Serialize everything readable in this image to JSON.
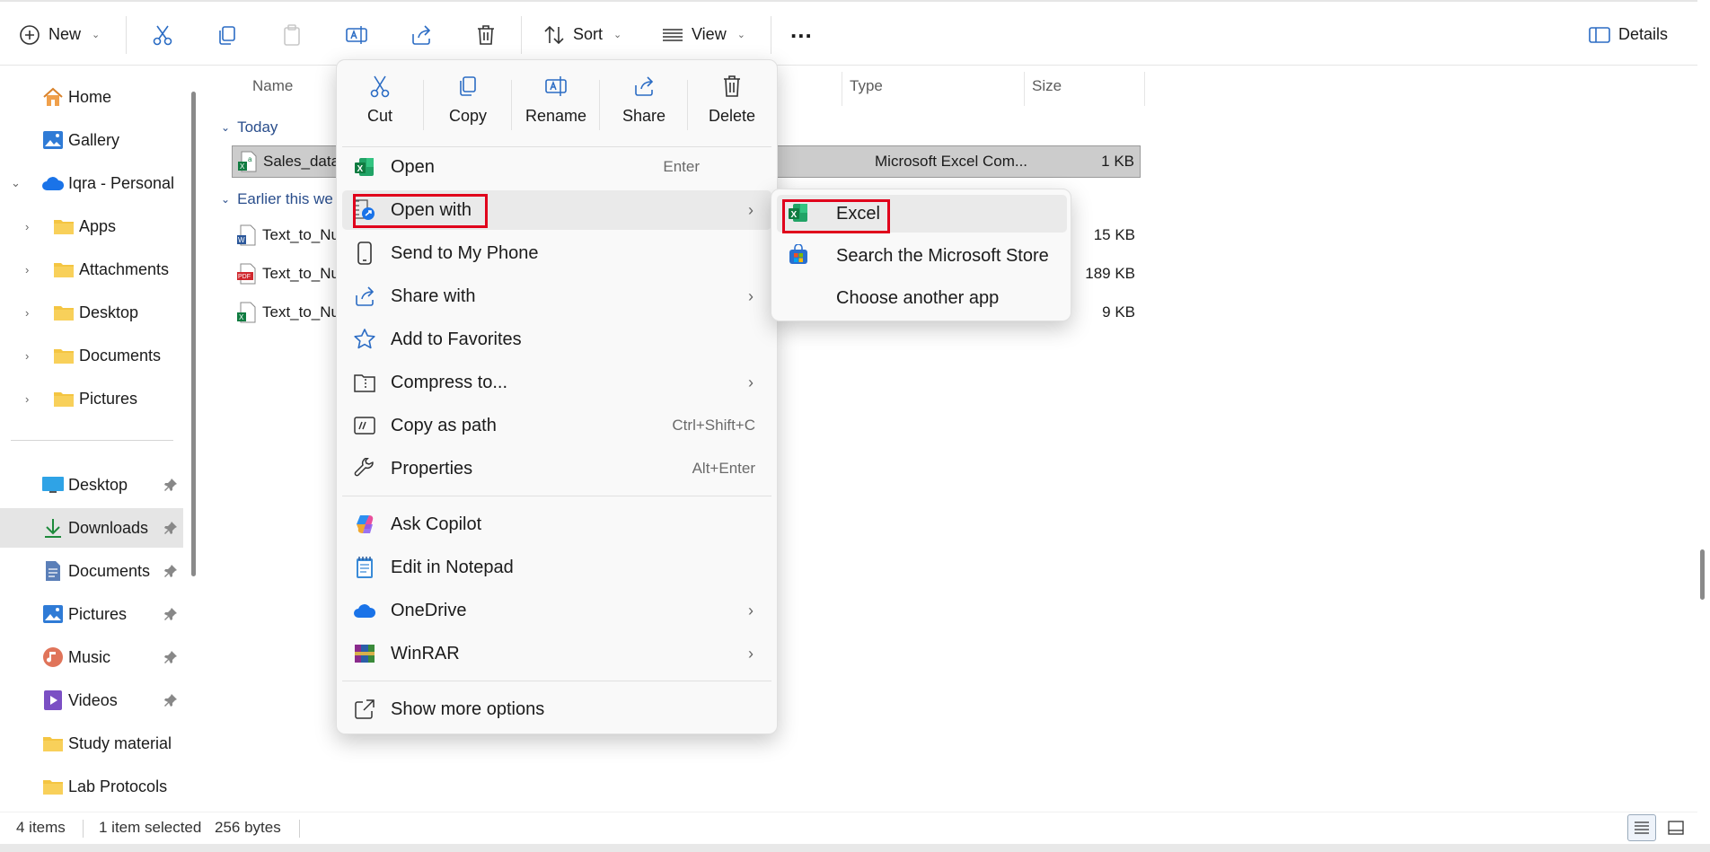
{
  "toolbar": {
    "new_label": "New",
    "sort_label": "Sort",
    "view_label": "View",
    "more_label": "...",
    "details_label": "Details"
  },
  "sidebar": {
    "quick_items": [
      {
        "label": "Home",
        "icon": "home-icon"
      },
      {
        "label": "Gallery",
        "icon": "gallery-icon"
      },
      {
        "label": "Iqra - Personal",
        "icon": "onedrive-cloud-icon"
      }
    ],
    "folders": [
      {
        "label": "Apps"
      },
      {
        "label": "Attachments"
      },
      {
        "label": "Desktop"
      },
      {
        "label": "Documents"
      },
      {
        "label": "Pictures"
      }
    ],
    "pinned": [
      {
        "label": "Desktop",
        "icon": "desktop-icon",
        "pinned": true
      },
      {
        "label": "Downloads",
        "icon": "downloads-icon",
        "pinned": true,
        "selected": true
      },
      {
        "label": "Documents",
        "icon": "documents-icon",
        "pinned": true
      },
      {
        "label": "Pictures",
        "icon": "pictures-icon",
        "pinned": true
      },
      {
        "label": "Music",
        "icon": "music-icon",
        "pinned": true
      },
      {
        "label": "Videos",
        "icon": "videos-icon",
        "pinned": true
      },
      {
        "label": "Study material",
        "icon": "folder-icon",
        "pinned": false
      },
      {
        "label": "Lab Protocols",
        "icon": "folder-icon",
        "pinned": false
      }
    ]
  },
  "columns": {
    "name": "Name",
    "type": "Type",
    "size": "Size"
  },
  "groups": [
    {
      "label": "Today"
    },
    {
      "label": "Earlier this we"
    }
  ],
  "files": [
    {
      "name": "Sales_data",
      "type": "Microsoft Excel Com...",
      "size": "1 KB",
      "icon": "excel-csv-file-icon",
      "selected": true
    },
    {
      "name": "Text_to_Nu",
      "type": "",
      "size": "15 KB",
      "icon": "word-file-icon"
    },
    {
      "name": "Text_to_Nu",
      "type": "",
      "size": "189 KB",
      "icon": "pdf-file-icon"
    },
    {
      "name": "Text_to_Nu",
      "type": "",
      "size": "9 KB",
      "icon": "excel-file-icon"
    }
  ],
  "status": {
    "item_count": "4 items",
    "selection": "1 item selected",
    "selection_size": "256 bytes"
  },
  "context_menu": {
    "quick_actions": [
      {
        "label": "Cut",
        "icon": "scissors-icon"
      },
      {
        "label": "Copy",
        "icon": "copy-icon"
      },
      {
        "label": "Rename",
        "icon": "rename-icon"
      },
      {
        "label": "Share",
        "icon": "share-icon"
      },
      {
        "label": "Delete",
        "icon": "trash-icon"
      }
    ],
    "items": [
      {
        "label": "Open",
        "shortcut": "Enter",
        "icon": "excel-icon"
      },
      {
        "label": "Open with",
        "shortcut": "",
        "icon": "open-with-icon",
        "submenu": true,
        "highlighted": true
      },
      {
        "label": "Send to My Phone",
        "shortcut": "",
        "icon": "phone-icon"
      },
      {
        "label": "Share with",
        "shortcut": "",
        "icon": "share-with-icon",
        "submenu": true
      },
      {
        "label": "Add to Favorites",
        "shortcut": "",
        "icon": "star-icon"
      },
      {
        "label": "Compress to...",
        "shortcut": "",
        "icon": "compress-icon",
        "submenu": true
      },
      {
        "label": "Copy as path",
        "shortcut": "Ctrl+Shift+C",
        "icon": "copy-path-icon"
      },
      {
        "label": "Properties",
        "shortcut": "Alt+Enter",
        "icon": "wrench-icon"
      },
      {
        "label": "Ask Copilot",
        "shortcut": "",
        "icon": "copilot-icon"
      },
      {
        "label": "Edit in Notepad",
        "shortcut": "",
        "icon": "notepad-icon"
      },
      {
        "label": "OneDrive",
        "shortcut": "",
        "icon": "onedrive-icon",
        "submenu": true
      },
      {
        "label": "WinRAR",
        "shortcut": "",
        "icon": "winrar-icon",
        "submenu": true
      },
      {
        "label": "Show more options",
        "shortcut": "",
        "icon": "more-options-icon"
      }
    ]
  },
  "submenu": {
    "items": [
      {
        "label": "Excel",
        "icon": "excel-icon",
        "highlighted": true
      },
      {
        "label": "Search the Microsoft Store",
        "icon": "store-icon"
      },
      {
        "label": "Choose another app",
        "icon": ""
      }
    ]
  },
  "colors": {
    "accent_red": "#e0001b",
    "group_blue": "#2a4e8c",
    "excel_green": "#107c41",
    "folder_yellow": "#f4c542"
  }
}
